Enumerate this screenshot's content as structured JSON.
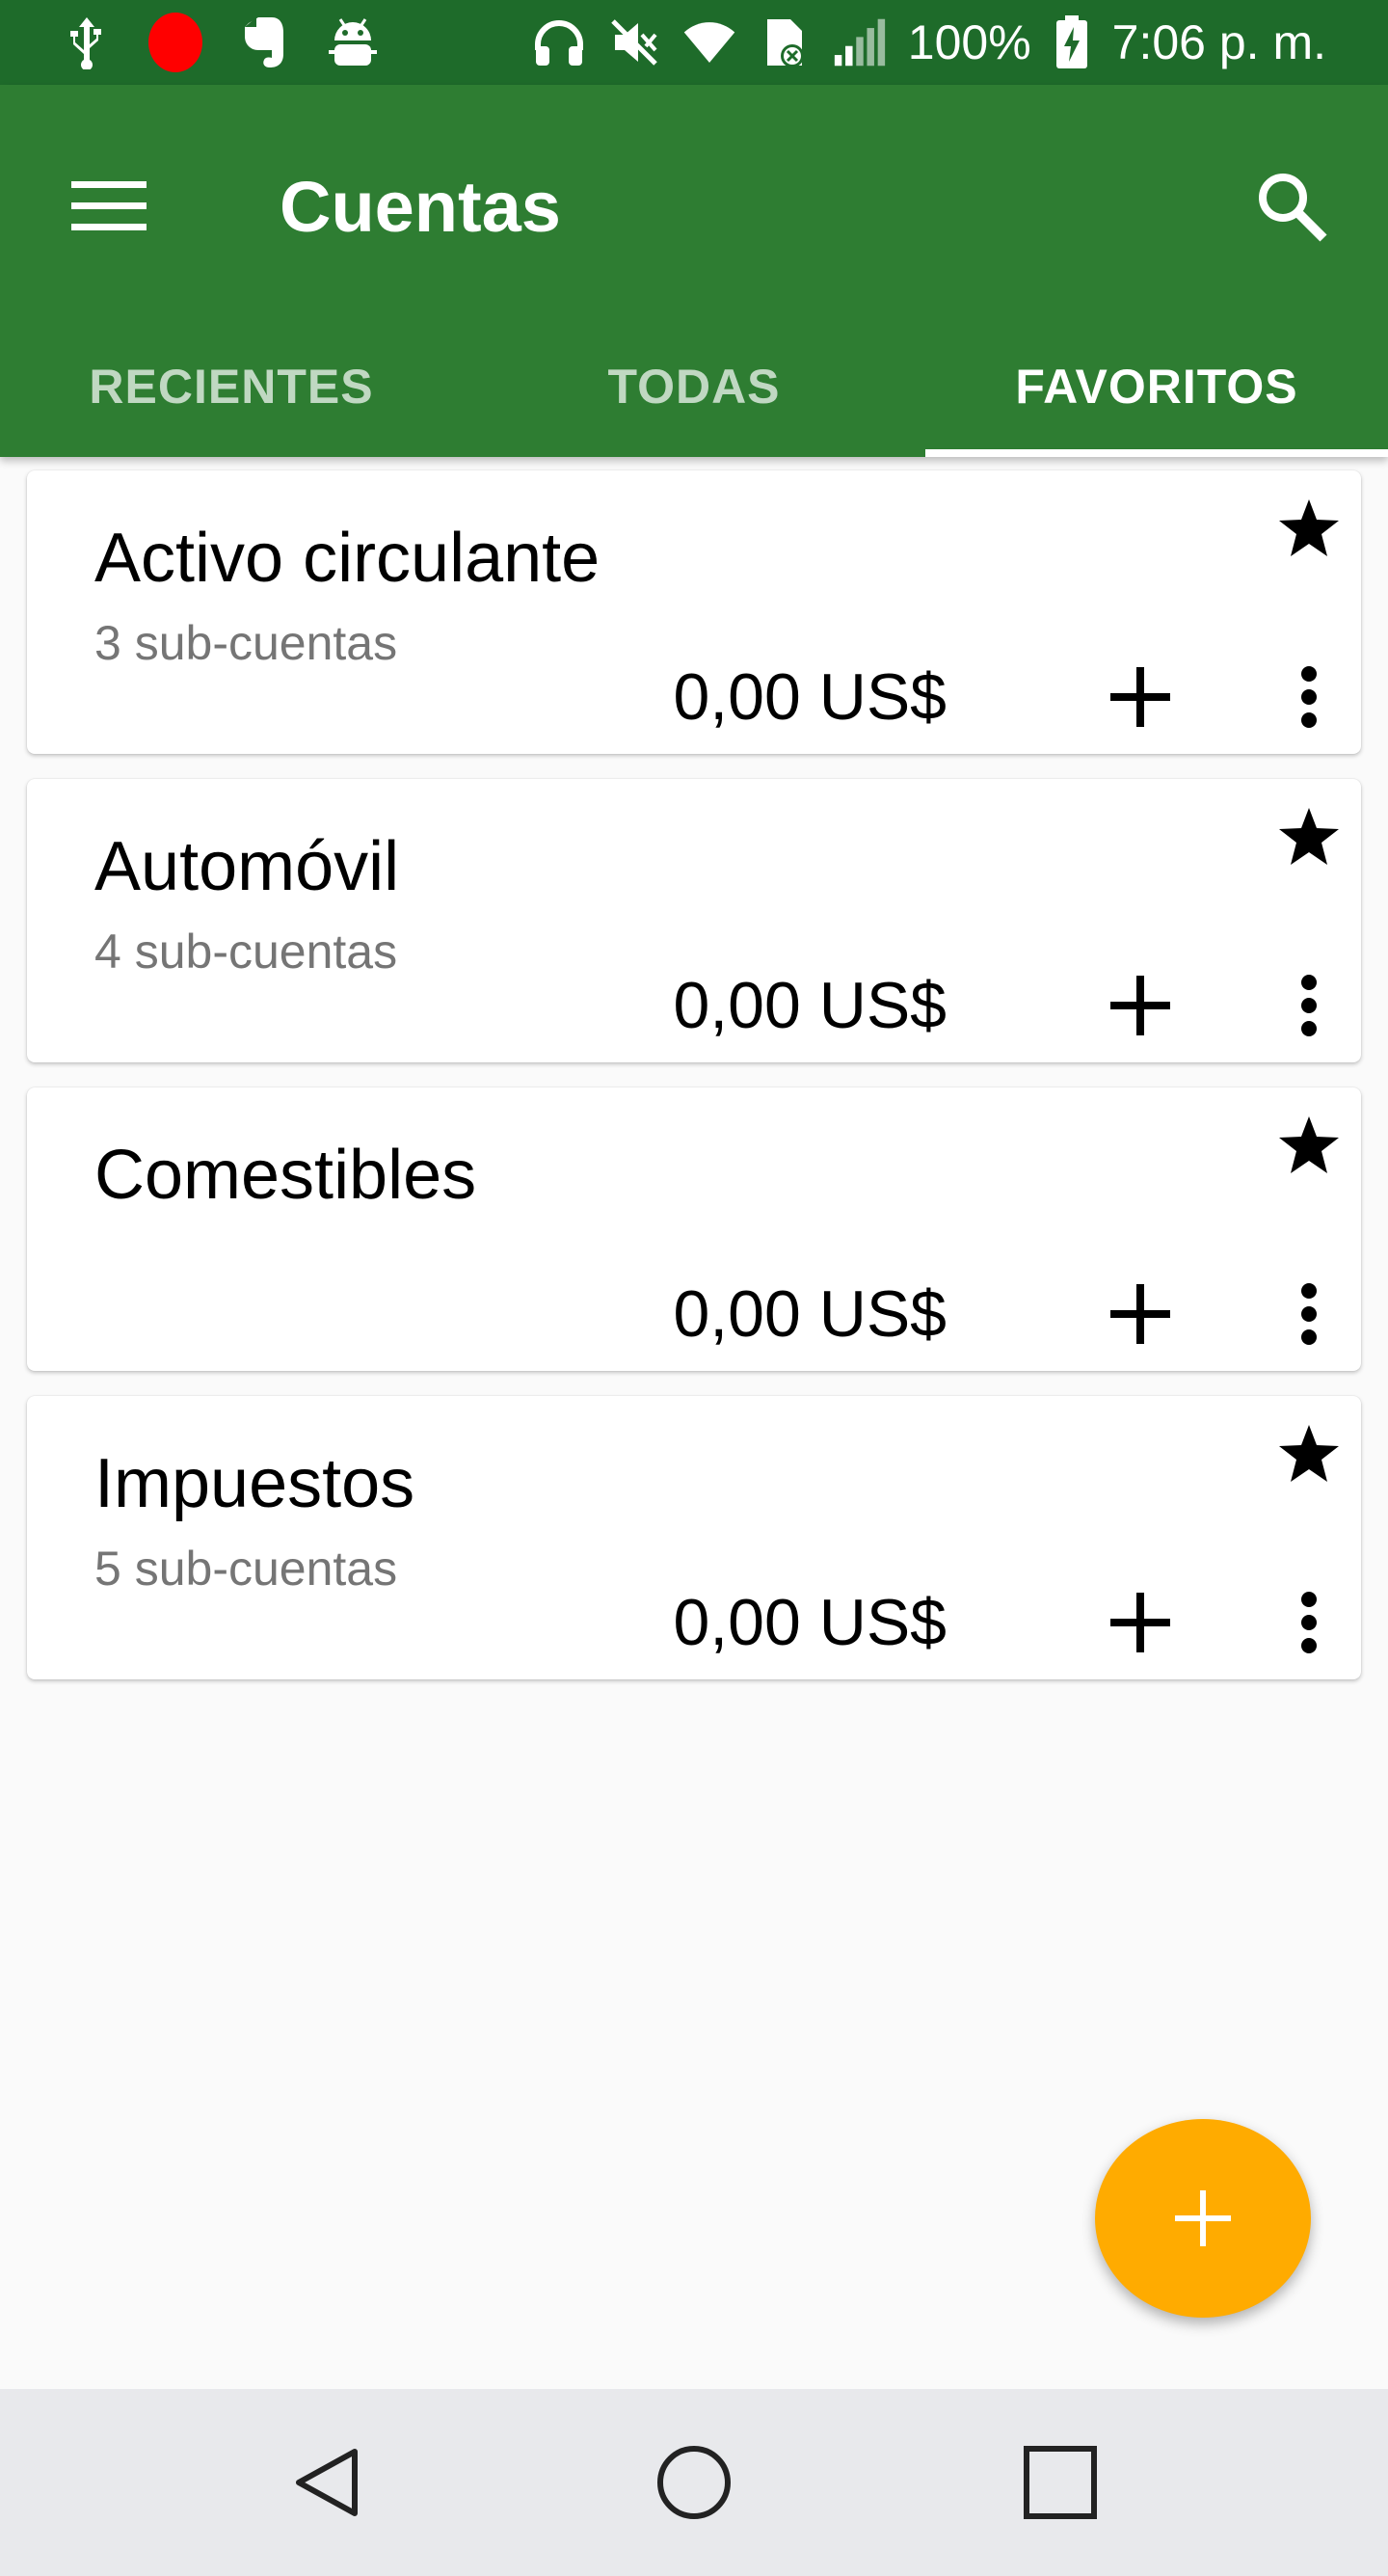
{
  "status_bar": {
    "battery": "100%",
    "time": "7:06 p. m.",
    "icons_left": [
      "usb-icon",
      "screen-record-icon",
      "evernote-icon",
      "android-debug-icon"
    ],
    "icons_right": [
      "headphones-icon",
      "mute-icon",
      "wifi-icon",
      "sim-error-icon",
      "signal-icon",
      "battery-charging-icon"
    ]
  },
  "app_bar": {
    "title": "Cuentas",
    "menu_icon": "hamburger-menu-icon",
    "search_icon": "search-icon",
    "color": "#2e7d32"
  },
  "tabs": [
    {
      "label": "RECIENTES",
      "active": false
    },
    {
      "label": "TODAS",
      "active": false
    },
    {
      "label": "FAVORITOS",
      "active": true
    }
  ],
  "accounts": [
    {
      "name": "Activo circulante",
      "subaccounts": "3 sub-cuentas",
      "balance": "0,00 US$",
      "favorite": true
    },
    {
      "name": "Automóvil",
      "subaccounts": "4 sub-cuentas",
      "balance": "0,00 US$",
      "favorite": true
    },
    {
      "name": "Comestibles",
      "subaccounts": "",
      "balance": "0,00 US$",
      "favorite": true
    },
    {
      "name": "Impuestos",
      "subaccounts": "5 sub-cuentas",
      "balance": "0,00 US$",
      "favorite": true
    }
  ],
  "fab": {
    "icon": "add-icon",
    "color": "#ffab00"
  },
  "nav_bar": {
    "buttons": [
      "back-icon",
      "home-icon",
      "recents-icon"
    ]
  }
}
